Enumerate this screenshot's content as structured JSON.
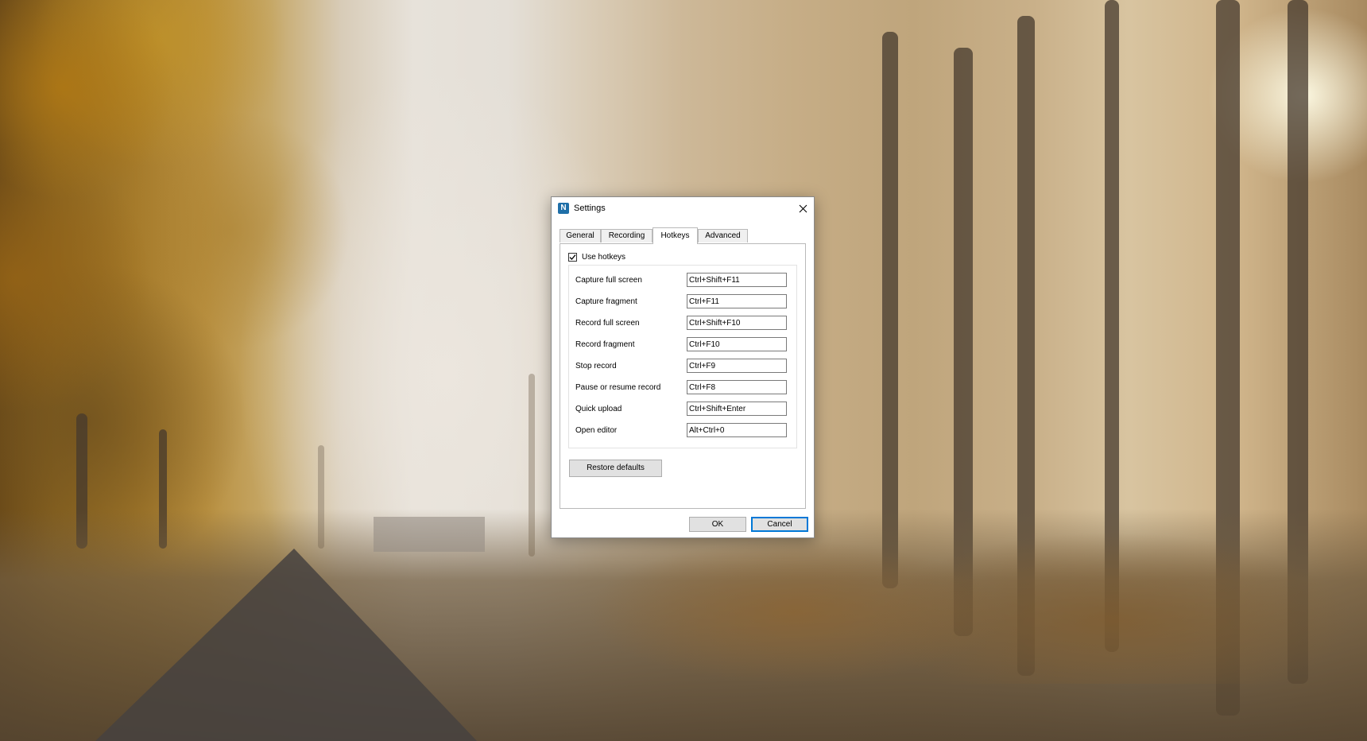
{
  "dialog": {
    "title": "Settings",
    "icon": "nimbus-app-icon",
    "close_glyph": "✕",
    "tabs": [
      {
        "label": "General",
        "active": false
      },
      {
        "label": "Recording",
        "active": false
      },
      {
        "label": "Hotkeys",
        "active": true
      },
      {
        "label": "Advanced",
        "active": false
      }
    ],
    "use_hotkeys": {
      "label": "Use hotkeys",
      "checked": true
    },
    "hotkeys": [
      {
        "label": "Capture full screen",
        "value": "Ctrl+Shift+F11"
      },
      {
        "label": "Capture fragment",
        "value": "Ctrl+F11"
      },
      {
        "label": "Record full screen",
        "value": "Ctrl+Shift+F10"
      },
      {
        "label": "Record fragment",
        "value": "Ctrl+F10"
      },
      {
        "label": "Stop record",
        "value": "Ctrl+F9"
      },
      {
        "label": "Pause or resume record",
        "value": "Ctrl+F8"
      },
      {
        "label": "Quick upload",
        "value": "Ctrl+Shift+Enter"
      },
      {
        "label": "Open editor",
        "value": "Alt+Ctrl+0"
      }
    ],
    "restore_defaults_label": "Restore defaults",
    "ok_label": "OK",
    "cancel_label": "Cancel"
  },
  "colors": {
    "focus_accent": "#0078d7",
    "app_icon": "#1f6fa8"
  }
}
